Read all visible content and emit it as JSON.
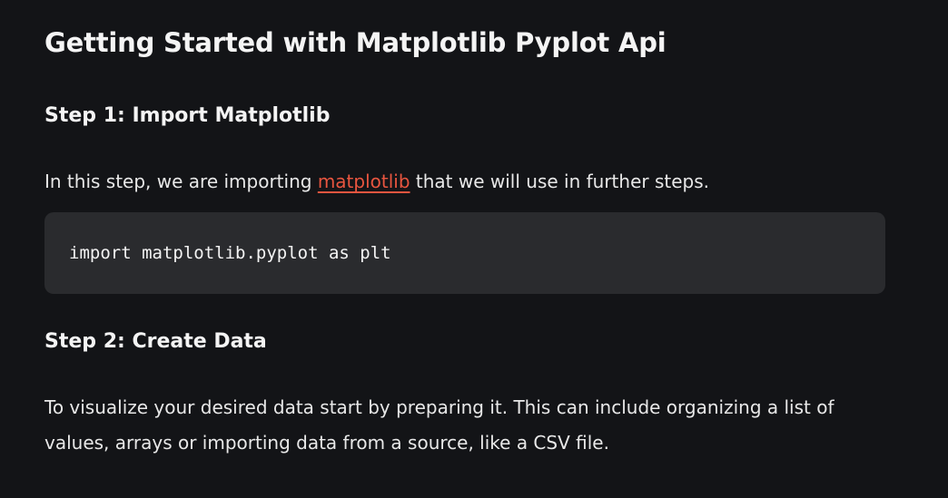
{
  "article": {
    "title": "Getting Started with Matplotlib Pyplot Api",
    "step1": {
      "heading": "Step 1: Import Matplotlib",
      "text_before": "In this step, we are importing ",
      "link_text": "matplotlib",
      "text_after": " that we will use in further steps.",
      "code": "import matplotlib.pyplot as plt"
    },
    "step2": {
      "heading": "Step 2: Create Data",
      "text": "To visualize your desired data start by preparing it. This can include organizing a list of values, arrays or importing data from a source, like a CSV file."
    }
  },
  "colors": {
    "background": "#131417",
    "code_background": "#2a2b2e",
    "link": "#e8553f",
    "text": "#f2f2f2"
  }
}
